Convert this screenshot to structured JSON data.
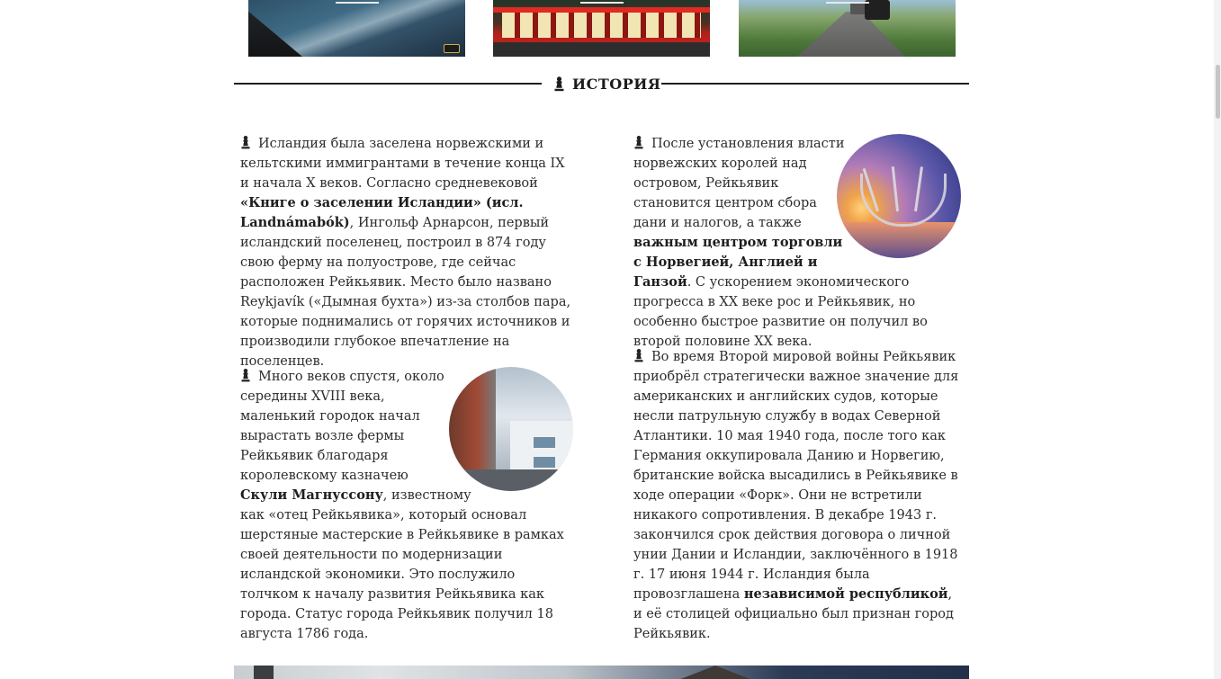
{
  "section": {
    "title": "ИСТОРИЯ",
    "icon": "chess-pawn-icon"
  },
  "thumbnails": [
    {
      "name": "coast-photo"
    },
    {
      "name": "red-shop-photo"
    },
    {
      "name": "road-suv-photo"
    }
  ],
  "paragraphs": {
    "p1": {
      "t1": "Исландия была заселена норвежскими и кельтскими иммигрантами в течение конца IX и начала X веков. Согласно средневековой ",
      "b1": "«Книге о заселении Исландии» (исл. Landnámabók)",
      "t2": ", Ингольф Арнарсон, первый исландский поселенец, построил в 874 году свою ферму на полуострове, где сейчас расположен Рейкьявик. Место было названо Reykjavík («Дымная бухта») из-за столбов пара, которые поднимались от горячих источников и производили глубокое впечатление на поселенцев."
    },
    "p2": {
      "t1": "Много веков спустя, около середины XVIII века, маленький городок начал вырастать возле фермы Рейкьявик благодаря королевскому казначею ",
      "b1": "Скули Магнуссону",
      "t2": ", известному как «отец Рейкьявика», который основал шерстяные мастерские в Рейкьявике в рамках своей деятельности по модернизации исландской экономики. Это послужило толчком к началу развития Рейкьявика как города. Статус города Рейкьявик получил 18 августа 1786 года."
    },
    "p3": {
      "t1": "После установления власти норвежских королей над островом, Рейкьявик становится центром сбора дани и налогов, а также ",
      "b1": "важным центром торговли с Норвегией, Англией и Ганзой",
      "t2": ". С ускорением экономического прогресса в XX веке рос и Рейкьявик, но особенно быстрое развитие он получил во второй половине XX века."
    },
    "p4": {
      "t1": "Во время Второй мировой войны Рейкьявик приобрёл стратегически важное значение для американских и английских судов, которые несли патрульную службу в водах Северной Атлантики. 10 мая 1940 года, после того как Германия оккупировала Данию и Норвегию, британские войска высадились в Рейкьявике в ходе операции «Форк». Они не встретили никакого сопротивления. В декабре 1943 г. закончился срок действия договора о личной унии Дании и Исландии, заключённого в 1918 г. 17 июня 1944 г. Исландия была провозглашена ",
      "b1": "независимой республикой",
      "t2": ", и её столицей официально был признан город Рейкьявик."
    }
  },
  "images": {
    "street_photo": "street-buildings-photo",
    "sun_voyager_photo": "sun-voyager-photo"
  }
}
